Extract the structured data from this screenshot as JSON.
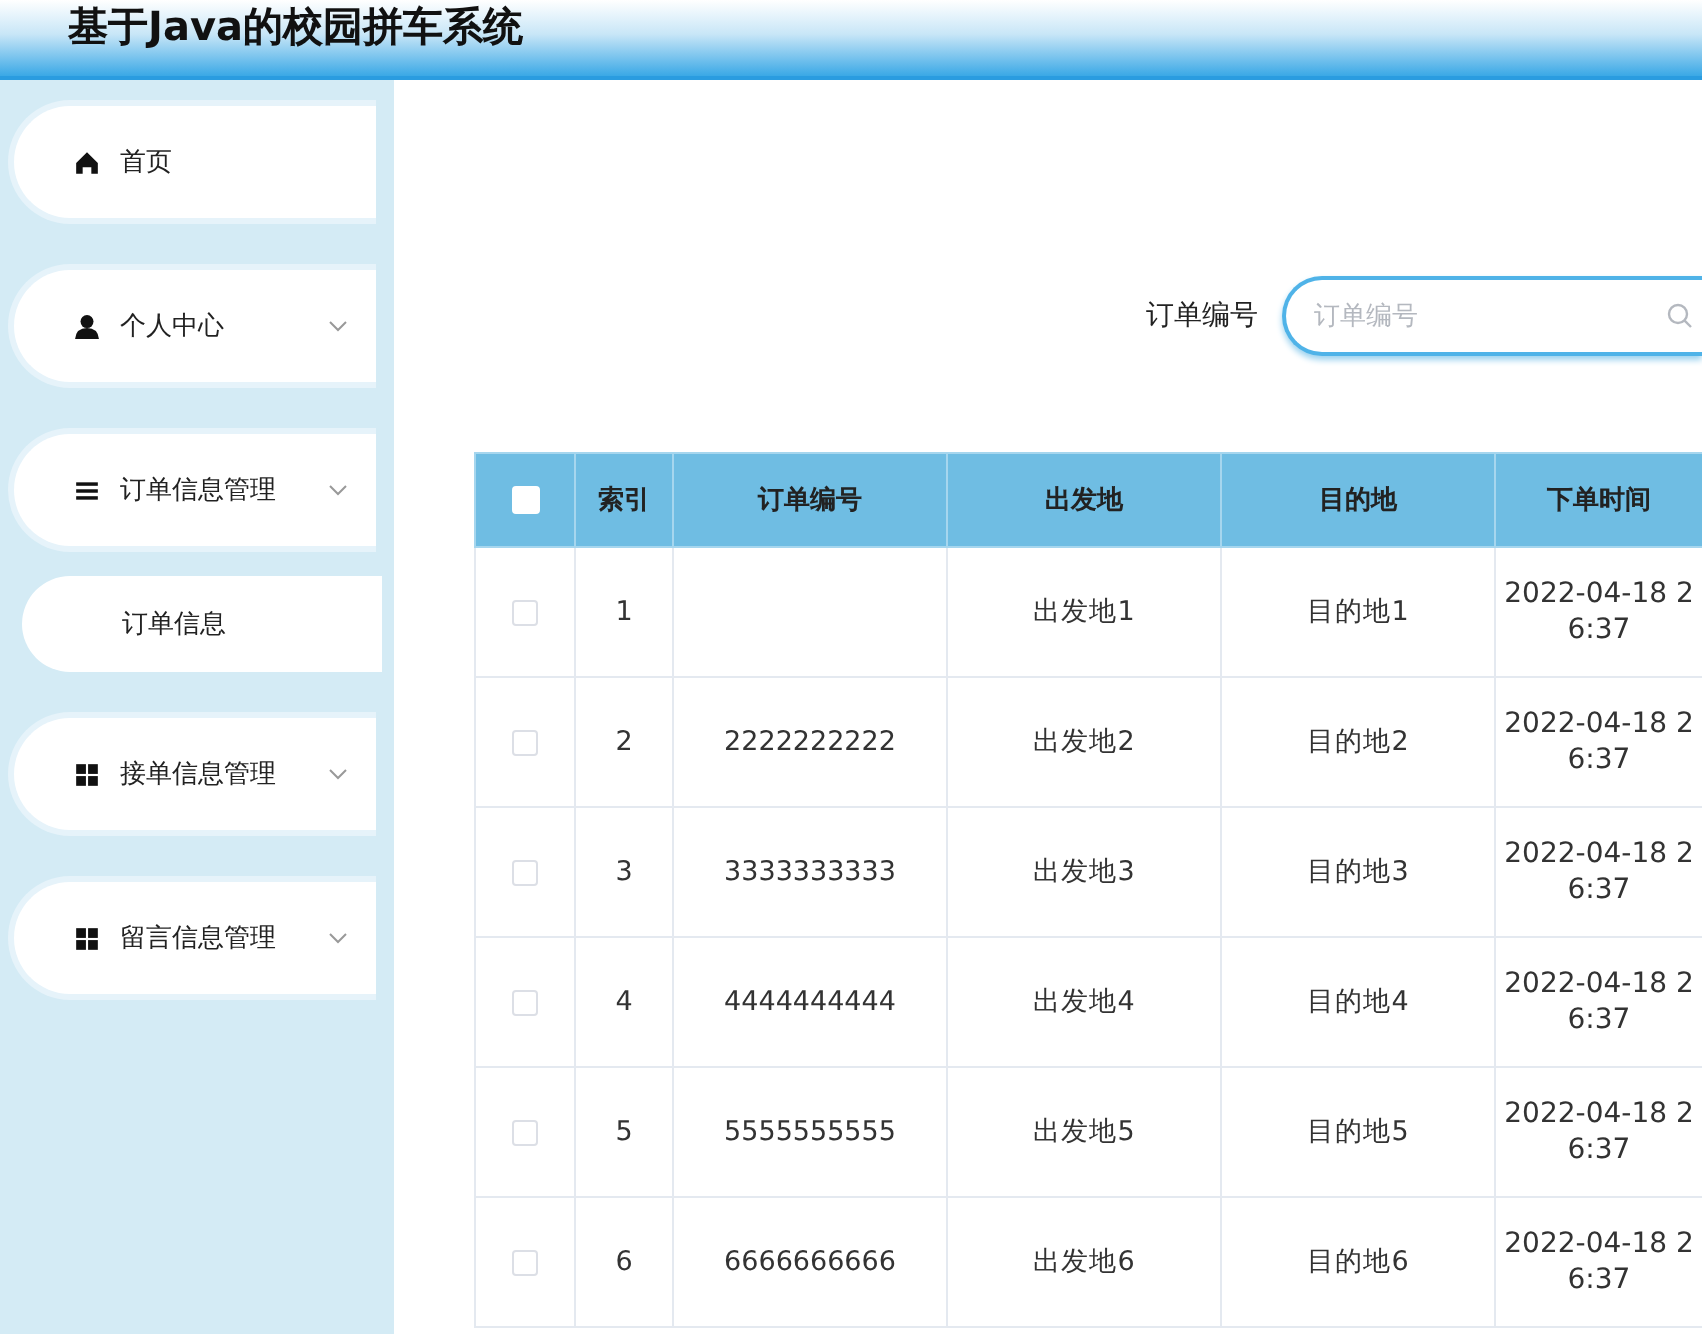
{
  "header": {
    "title": "基于Java的校园拼车系统"
  },
  "sidebar": {
    "items": [
      {
        "label": "首页",
        "kind": "link"
      },
      {
        "label": "个人中心",
        "kind": "menu"
      },
      {
        "label": "订单信息管理",
        "kind": "menu",
        "children": [
          {
            "label": "订单信息"
          }
        ]
      },
      {
        "label": "接单信息管理",
        "kind": "menu"
      },
      {
        "label": "留言信息管理",
        "kind": "menu"
      }
    ]
  },
  "search": {
    "label": "订单编号",
    "placeholder": "订单编号"
  },
  "table": {
    "all_checked": false,
    "columns": [
      "索引",
      "订单编号",
      "出发地",
      "目的地",
      "下单时间"
    ],
    "rows": [
      {
        "checked": false,
        "index": "1",
        "from": "出发地1",
        "to": "目的地1",
        "time_line_1": "2022-04-18 2",
        "time_line_2": "6:37"
      },
      {
        "checked": false,
        "index": "2",
        "order_no": "2222222222",
        "from": "出发地2",
        "to": "目的地2",
        "time_line_1": "2022-04-18 2",
        "time_line_2": "6:37"
      },
      {
        "checked": false,
        "index": "3",
        "order_no": "3333333333",
        "from": "出发地3",
        "to": "目的地3",
        "time_line_1": "2022-04-18 2",
        "time_line_2": "6:37"
      },
      {
        "checked": false,
        "index": "4",
        "order_no": "4444444444",
        "from": "出发地4",
        "to": "目的地4",
        "time_line_1": "2022-04-18 2",
        "time_line_2": "6:37"
      },
      {
        "checked": false,
        "index": "5",
        "order_no": "5555555555",
        "from": "出发地5",
        "to": "目的地5",
        "time_line_1": "2022-04-18 2",
        "time_line_2": "6:37"
      },
      {
        "checked": false,
        "index": "6",
        "order_no": "6666666666",
        "from": "出发地6",
        "to": "目的地6",
        "time_line_1": "2022-04-18 2",
        "time_line_2": "6:37"
      }
    ]
  }
}
